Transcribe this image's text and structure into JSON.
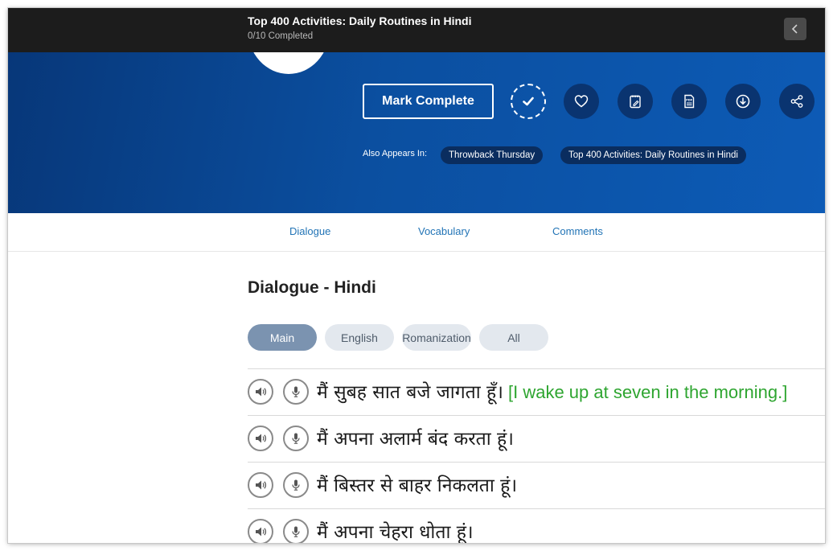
{
  "header": {
    "title": "Top 400 Activities: Daily Routines in Hindi",
    "progress": "0/10 Completed"
  },
  "hero": {
    "mark_complete_label": "Mark Complete",
    "actions": [
      "check-icon",
      "heart-icon",
      "notes-icon",
      "pdf-icon",
      "download-icon",
      "share-icon"
    ],
    "also_appears_label": "Also Appears In:",
    "chips": [
      "Throwback Thursday",
      "Top 400 Activities: Daily Routines in Hindi"
    ]
  },
  "tabs": [
    "Dialogue",
    "Vocabulary",
    "Comments"
  ],
  "section_title": "Dialogue - Hindi",
  "filters": {
    "items": [
      "Main",
      "English",
      "Romanization",
      "All"
    ],
    "selected": "Main"
  },
  "lines": [
    {
      "hindi": "मैं सुबह सात बजे जागता हूँ।",
      "english": "[I wake up at seven in the morning.]"
    },
    {
      "hindi": "मैं अपना अलार्म बंद करता हूं।",
      "english": ""
    },
    {
      "hindi": "मैं बिस्तर से बाहर निकलता हूं।",
      "english": ""
    },
    {
      "hindi": "मैं अपना चेहरा धोता हूं।",
      "english": ""
    }
  ],
  "colors": {
    "topbar": "#1c1c1c",
    "hero_start": "#073779",
    "hero_end": "#0d5bb6",
    "tab_link": "#2274b6",
    "pill_active": "#7b93b0",
    "pill_inactive": "#e3e8ee",
    "english_text": "#2ea530"
  }
}
